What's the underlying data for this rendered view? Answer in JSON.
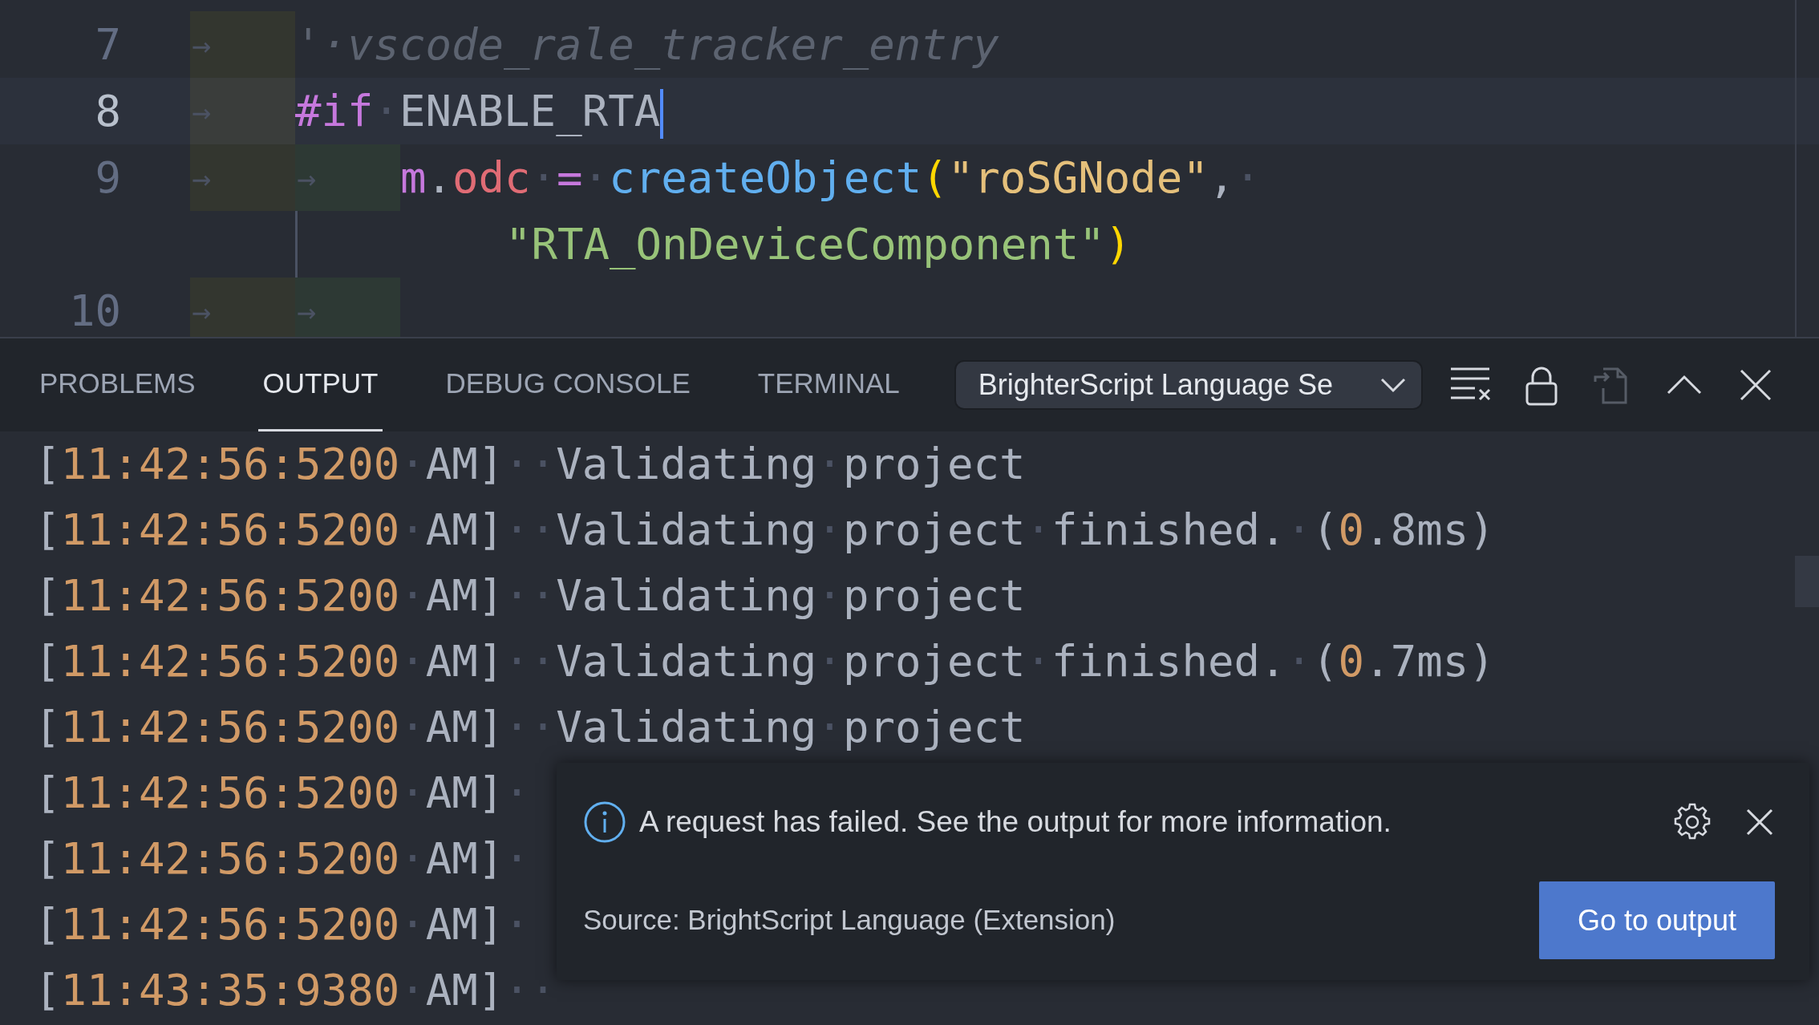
{
  "editor": {
    "lines": [
      {
        "kind": "line",
        "number": "7",
        "current": false,
        "cursor": false,
        "tabs": [
          "→"
        ],
        "tokens": [
          {
            "kind": "comment",
            "text": "'·vscode_rale_tracker_entry"
          }
        ]
      },
      {
        "kind": "line",
        "number": "8",
        "current": true,
        "cursor": true,
        "tabs": [
          "→"
        ],
        "tokens": [
          {
            "kind": "keyword",
            "text": "#if"
          },
          {
            "kind": "space",
            "text": "·"
          },
          {
            "kind": "plain",
            "text": "ENABLE_RTA"
          }
        ]
      },
      {
        "kind": "line",
        "number": "9",
        "current": false,
        "cursor": false,
        "tabs": [
          "→",
          "→"
        ],
        "tokens": [
          {
            "kind": "keyword",
            "text": "m"
          },
          {
            "kind": "plain",
            "text": "."
          },
          {
            "kind": "property",
            "text": "odc"
          },
          {
            "kind": "space",
            "text": "·"
          },
          {
            "kind": "keyword",
            "text": "="
          },
          {
            "kind": "space",
            "text": "·"
          },
          {
            "kind": "function",
            "text": "createObject"
          },
          {
            "kind": "bracket",
            "text": "("
          },
          {
            "kind": "string-key",
            "text": "\"roSGNode\""
          },
          {
            "kind": "plain",
            "text": ","
          },
          {
            "kind": "space",
            "text": "·"
          }
        ]
      },
      {
        "kind": "wrap",
        "cursor": false,
        "tokens": [
          {
            "kind": "string",
            "text": "\"RTA_OnDeviceComponent\""
          },
          {
            "kind": "bracket",
            "text": ")"
          }
        ]
      },
      {
        "kind": "line",
        "number": "10",
        "current": false,
        "tabs": [
          "→",
          "→"
        ]
      }
    ]
  },
  "panel": {
    "tabs": [
      {
        "label": "PROBLEMS",
        "selected": false
      },
      {
        "label": "OUTPUT",
        "selected": true
      },
      {
        "label": "DEBUG CONSOLE",
        "selected": false
      },
      {
        "label": "TERMINAL",
        "selected": false
      }
    ],
    "channel_select": {
      "value": "BrighterScript Language Se"
    },
    "actions": [
      {
        "kind": "clear",
        "disabled": false
      },
      {
        "kind": "lock",
        "disabled": false
      },
      {
        "kind": "copy",
        "disabled": true
      },
      {
        "kind": "maximize",
        "disabled": false
      },
      {
        "kind": "close",
        "disabled": false
      }
    ],
    "output_lines": [
      [
        {
          "kind": "plain",
          "text": "["
        },
        {
          "kind": "number",
          "text": "11:42:56:5200"
        },
        {
          "kind": "space",
          "text": "·"
        },
        {
          "kind": "plain",
          "text": "AM]"
        },
        {
          "kind": "space",
          "text": "··"
        },
        {
          "kind": "plain",
          "text": "Validating"
        },
        {
          "kind": "space",
          "text": "·"
        },
        {
          "kind": "plain",
          "text": "project"
        }
      ],
      [
        {
          "kind": "plain",
          "text": "["
        },
        {
          "kind": "number",
          "text": "11:42:56:5200"
        },
        {
          "kind": "space",
          "text": "·"
        },
        {
          "kind": "plain",
          "text": "AM]"
        },
        {
          "kind": "space",
          "text": "··"
        },
        {
          "kind": "plain",
          "text": "Validating"
        },
        {
          "kind": "space",
          "text": "·"
        },
        {
          "kind": "plain",
          "text": "project"
        },
        {
          "kind": "space",
          "text": "·"
        },
        {
          "kind": "plain",
          "text": "finished."
        },
        {
          "kind": "space",
          "text": "·"
        },
        {
          "kind": "plain",
          "text": "("
        },
        {
          "kind": "number",
          "text": "0"
        },
        {
          "kind": "plain",
          "text": ".8ms)"
        }
      ],
      [
        {
          "kind": "plain",
          "text": "["
        },
        {
          "kind": "number",
          "text": "11:42:56:5200"
        },
        {
          "kind": "space",
          "text": "·"
        },
        {
          "kind": "plain",
          "text": "AM]"
        },
        {
          "kind": "space",
          "text": "··"
        },
        {
          "kind": "plain",
          "text": "Validating"
        },
        {
          "kind": "space",
          "text": "·"
        },
        {
          "kind": "plain",
          "text": "project"
        }
      ],
      [
        {
          "kind": "plain",
          "text": "["
        },
        {
          "kind": "number",
          "text": "11:42:56:5200"
        },
        {
          "kind": "space",
          "text": "·"
        },
        {
          "kind": "plain",
          "text": "AM]"
        },
        {
          "kind": "space",
          "text": "··"
        },
        {
          "kind": "plain",
          "text": "Validating"
        },
        {
          "kind": "space",
          "text": "·"
        },
        {
          "kind": "plain",
          "text": "project"
        },
        {
          "kind": "space",
          "text": "·"
        },
        {
          "kind": "plain",
          "text": "finished."
        },
        {
          "kind": "space",
          "text": "·"
        },
        {
          "kind": "plain",
          "text": "("
        },
        {
          "kind": "number",
          "text": "0"
        },
        {
          "kind": "plain",
          "text": ".7ms)"
        }
      ],
      [
        {
          "kind": "plain",
          "text": "["
        },
        {
          "kind": "number",
          "text": "11:42:56:5200"
        },
        {
          "kind": "space",
          "text": "·"
        },
        {
          "kind": "plain",
          "text": "AM]"
        },
        {
          "kind": "space",
          "text": "··"
        },
        {
          "kind": "plain",
          "text": "Validating"
        },
        {
          "kind": "space",
          "text": "·"
        },
        {
          "kind": "plain",
          "text": "project"
        }
      ],
      [
        {
          "kind": "plain",
          "text": "["
        },
        {
          "kind": "number",
          "text": "11:42:56:5200"
        },
        {
          "kind": "space",
          "text": "·"
        },
        {
          "kind": "plain",
          "text": "AM]"
        },
        {
          "kind": "space",
          "text": "·"
        }
      ],
      [
        {
          "kind": "plain",
          "text": "["
        },
        {
          "kind": "number",
          "text": "11:42:56:5200"
        },
        {
          "kind": "space",
          "text": "·"
        },
        {
          "kind": "plain",
          "text": "AM]"
        },
        {
          "kind": "space",
          "text": "·"
        }
      ],
      [
        {
          "kind": "plain",
          "text": "["
        },
        {
          "kind": "number",
          "text": "11:42:56:5200"
        },
        {
          "kind": "space",
          "text": "·"
        },
        {
          "kind": "plain",
          "text": "AM]"
        },
        {
          "kind": "space",
          "text": "·"
        }
      ],
      [
        {
          "kind": "plain",
          "text": "["
        },
        {
          "kind": "number",
          "text": "11:43:35:9380"
        },
        {
          "kind": "space",
          "text": "·"
        },
        {
          "kind": "plain",
          "text": "AM]"
        },
        {
          "kind": "space",
          "text": "··"
        }
      ]
    ]
  },
  "notification": {
    "message": "A request has failed. See the output for more information.",
    "source": "Source: BrightScript Language (Extension)",
    "button": "Go to output"
  }
}
